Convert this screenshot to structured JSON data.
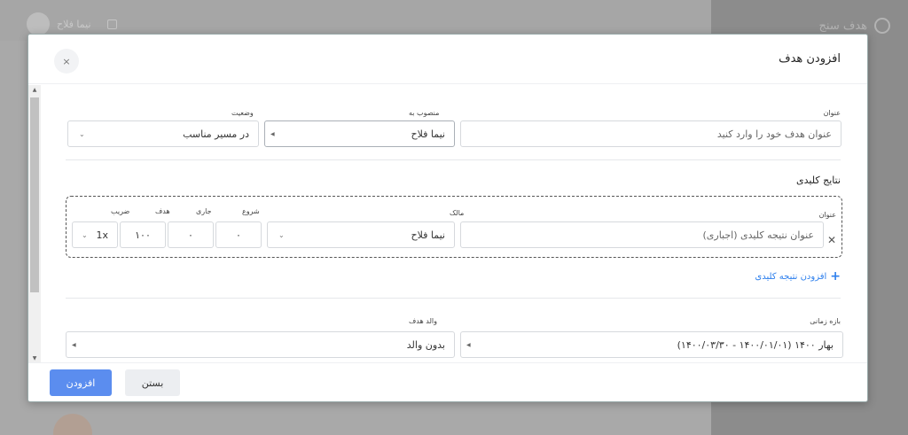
{
  "background": {
    "user_name": "نیما فلاح",
    "brand": "هدف سنج"
  },
  "modal": {
    "title": "افزودن هدف",
    "close_icon": "×",
    "fields": {
      "title_label": "عنوان",
      "title_placeholder": "عنوان هدف خود را وارد کنید",
      "assigned_label": "منصوب به",
      "assigned_value": "نیما فلاح",
      "status_label": "وضعیت",
      "status_value": "در مسیر مناسب"
    },
    "key_results": {
      "section_title": "نتایج کلیدی",
      "col_title": "عنوان",
      "col_owner": "مالک",
      "col_start": "شروع",
      "col_current": "جاری",
      "col_target": "هدف",
      "col_factor": "ضریب",
      "row": {
        "title_placeholder": "عنوان نتیجه کلیدی (اجباری)",
        "owner": "نیما فلاح",
        "start": "۰",
        "current": "۰",
        "target": "۱۰۰",
        "factor": "1x"
      },
      "add_label": "افزودن نتیجه کلیدی"
    },
    "period": {
      "label": "بازه زمانی",
      "value": "بهار ۱۴۰۰ (۱۴۰۰/۰۱/۰۱ - ۱۴۰۰/۰۳/۳۰)"
    },
    "parent": {
      "label": "والد هدف",
      "value": "بدون والد"
    },
    "buttons": {
      "add": "افزودن",
      "close": "بستن"
    }
  },
  "colors": {
    "primary": "#5b8def",
    "link": "#2f80ed",
    "overlay": "#a9a9a9"
  }
}
